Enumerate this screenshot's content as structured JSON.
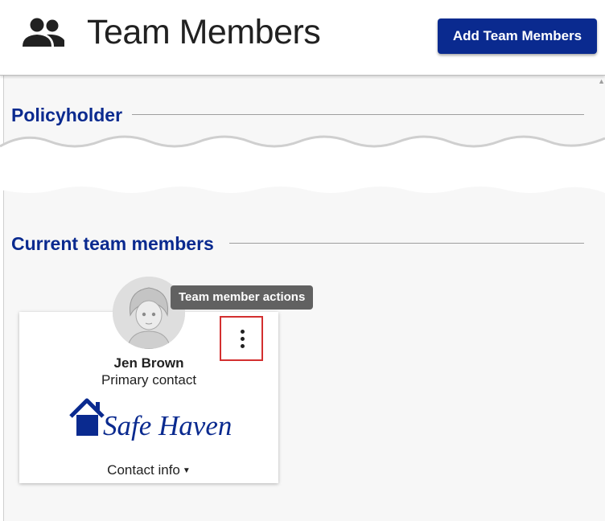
{
  "header": {
    "title": "Team Members",
    "icon": "people-icon",
    "add_button_label": "Add Team Members"
  },
  "sections": {
    "policyholder_title": "Policyholder",
    "current_team_title": "Current team members"
  },
  "tooltip": {
    "text": "Team member actions"
  },
  "member_card": {
    "name": "Jen Brown",
    "role": "Primary contact",
    "logo_text": "Safe Haven",
    "contact_toggle_label": "Contact info",
    "avatar_icon": "avatar-sketch",
    "actions_icon": "kebab-menu-icon"
  },
  "colors": {
    "brand_blue": "#0a2a8f",
    "highlight_red": "#d32f2f",
    "tooltip_bg": "#616161",
    "panel_bg": "#f7f7f7"
  }
}
